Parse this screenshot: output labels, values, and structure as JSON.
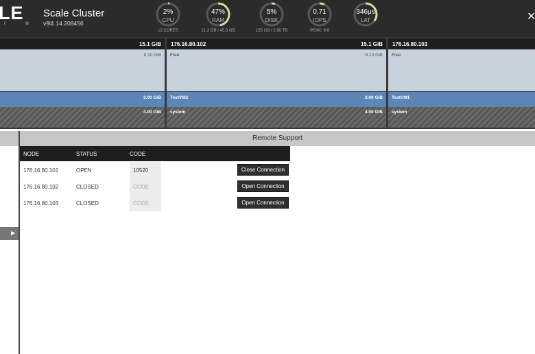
{
  "header": {
    "logo_text": "LE",
    "logo_sub": "I N G",
    "cluster_name": "Scale Cluster",
    "version": "v9.1.14.208456",
    "close_glyph": "✕",
    "gauges": [
      {
        "value": "2%",
        "label": "CPU",
        "sub": "12 CORES",
        "fraction": 0.02
      },
      {
        "value": "47%",
        "label": "RAM",
        "sub": "21.2 GB / 45.3 GB",
        "fraction": 0.47
      },
      {
        "value": "5%",
        "label": "DISK",
        "sub": "155 GB / 2.90 TB",
        "fraction": 0.05
      },
      {
        "value": "0.71",
        "label": "IOPS",
        "sub": "PEAK: 9.6",
        "fraction": 0.07
      },
      {
        "value": "346μs",
        "label": "LAT",
        "sub": "",
        "fraction": 0.35
      }
    ],
    "gauge_color": "#c9e09a"
  },
  "nodes": [
    {
      "ip": "",
      "total": "15.1 GiB",
      "free_label": "",
      "free_value": "8.10 GiB",
      "vm_label": "",
      "vm_value": "3.00 GiB",
      "sys_label": "",
      "sys_value": "4.00 GiB"
    },
    {
      "ip": "176.16.80.102",
      "total": "15.1 GiB",
      "free_label": "Free",
      "free_value": "8.10 GiB",
      "vm_label": "TestVM2",
      "vm_value": "3.00 GiB",
      "sys_label": "system",
      "sys_value": "4.00 GiB"
    },
    {
      "ip": "176.16.80.103",
      "total": "",
      "free_label": "Free",
      "free_value": "",
      "vm_label": "TestVM1",
      "vm_value": "",
      "sys_label": "system",
      "sys_value": ""
    }
  ],
  "sidebar": {
    "expand_glyph": "▶"
  },
  "remote_support": {
    "title": "Remote Support",
    "columns": [
      "NODE",
      "STATUS",
      "CODE"
    ],
    "rows": [
      {
        "node": "176.16.80.101",
        "status": "OPEN",
        "code": "10520",
        "code_empty": false,
        "action": "Close Connection"
      },
      {
        "node": "176.16.80.102",
        "status": "CLOSED",
        "code": "CODE",
        "code_empty": true,
        "action": "Open Connection"
      },
      {
        "node": "176.16.80.103",
        "status": "CLOSED",
        "code": "CODE",
        "code_empty": true,
        "action": "Open Connection"
      }
    ]
  }
}
